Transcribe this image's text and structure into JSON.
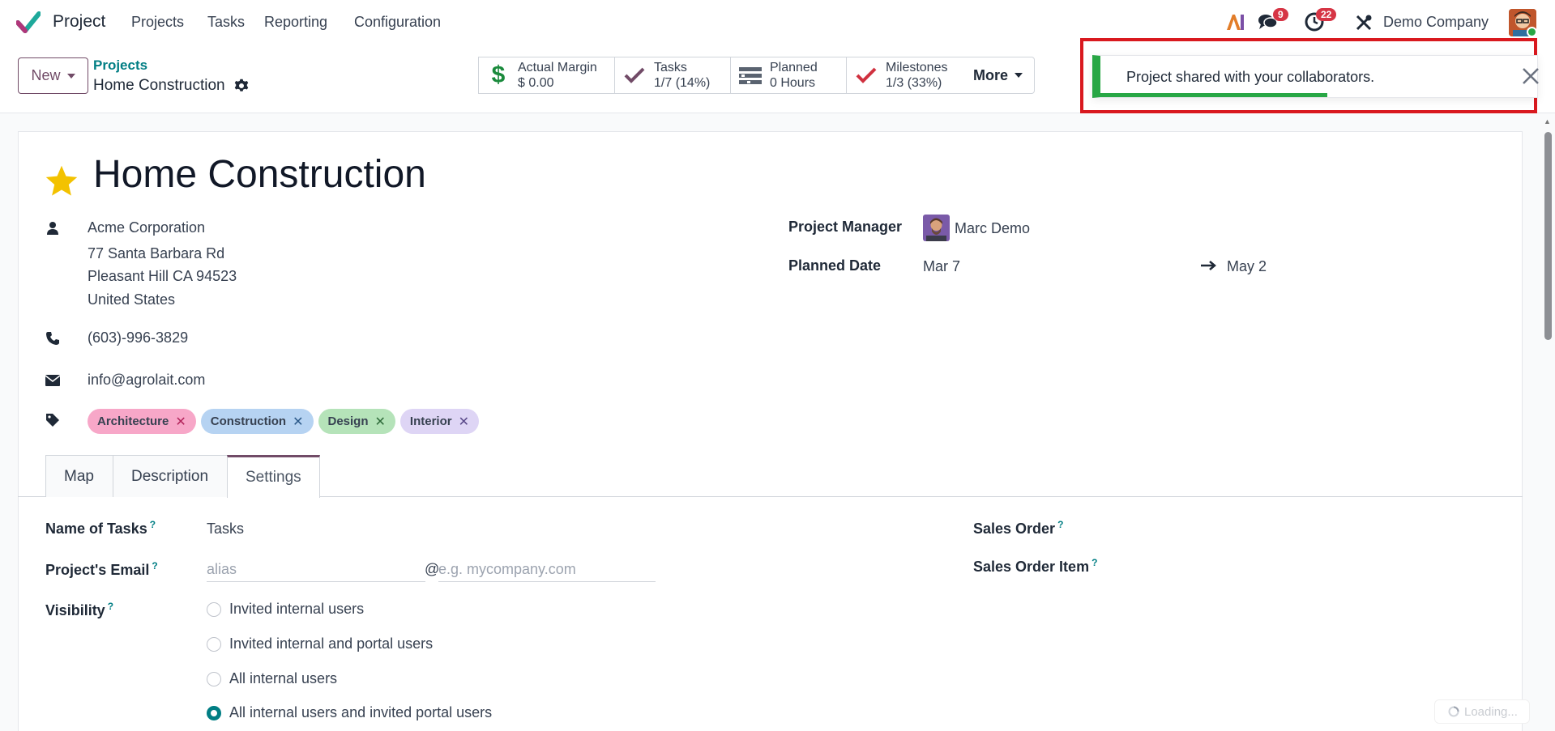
{
  "navbar": {
    "app_name": "Project",
    "menu": [
      "Projects",
      "Tasks",
      "Reporting",
      "Configuration"
    ],
    "messages_count": "9",
    "activities_count": "22",
    "company": "Demo Company"
  },
  "control": {
    "new_label": "New",
    "breadcrumb_parent": "Projects",
    "breadcrumb_current": "Home Construction",
    "stats": [
      {
        "label": "Actual Margin",
        "value": "$ 0.00",
        "icon": "dollar-icon"
      },
      {
        "label": "Tasks",
        "value": "1/7 (14%)",
        "icon": "check-icon"
      },
      {
        "label": "Planned",
        "value": "0 Hours",
        "icon": "planning-icon"
      },
      {
        "label": "Milestones",
        "value": "1/3 (33%)",
        "icon": "check-icon"
      }
    ],
    "more_label": "More"
  },
  "notification": {
    "message": "Project shared with your collaborators.",
    "progress": 0.52,
    "color": "#28a745"
  },
  "project": {
    "title": "Home Construction",
    "customer": "Acme Corporation",
    "address_line1": "77 Santa Barbara Rd",
    "address_line2": "Pleasant Hill CA 94523",
    "address_line3": "United States",
    "phone": "(603)-996-3829",
    "email": "info@agrolait.com",
    "tags": [
      {
        "label": "Architecture",
        "color": "#f7a7c8"
      },
      {
        "label": "Construction",
        "color": "#b6d3f2"
      },
      {
        "label": "Design",
        "color": "#b5e3b9"
      },
      {
        "label": "Interior",
        "color": "#ded5f5"
      }
    ],
    "manager_label": "Project Manager",
    "manager": "Marc Demo",
    "planned_date_label": "Planned Date",
    "date_start": "Mar 7",
    "date_end": "May 2"
  },
  "tabs": [
    "Map",
    "Description",
    "Settings"
  ],
  "settings": {
    "name_of_tasks_label": "Name of Tasks",
    "name_of_tasks_value": "Tasks",
    "project_email_label": "Project's Email",
    "alias_placeholder": "alias",
    "at": "@",
    "domain_placeholder": "e.g. mycompany.com",
    "visibility_label": "Visibility",
    "visibility_options": [
      "Invited internal users",
      "Invited internal and portal users",
      "All internal users",
      "All internal users and invited portal users"
    ],
    "visibility_selected_index": 3,
    "sales_order_label": "Sales Order",
    "sales_order_item_label": "Sales Order Item",
    "help_mark": "?"
  },
  "loading_text": "Loading...",
  "colors": {
    "brand": "#714b67",
    "accent": "#017e84",
    "highlight_frame": "#d9191f"
  }
}
